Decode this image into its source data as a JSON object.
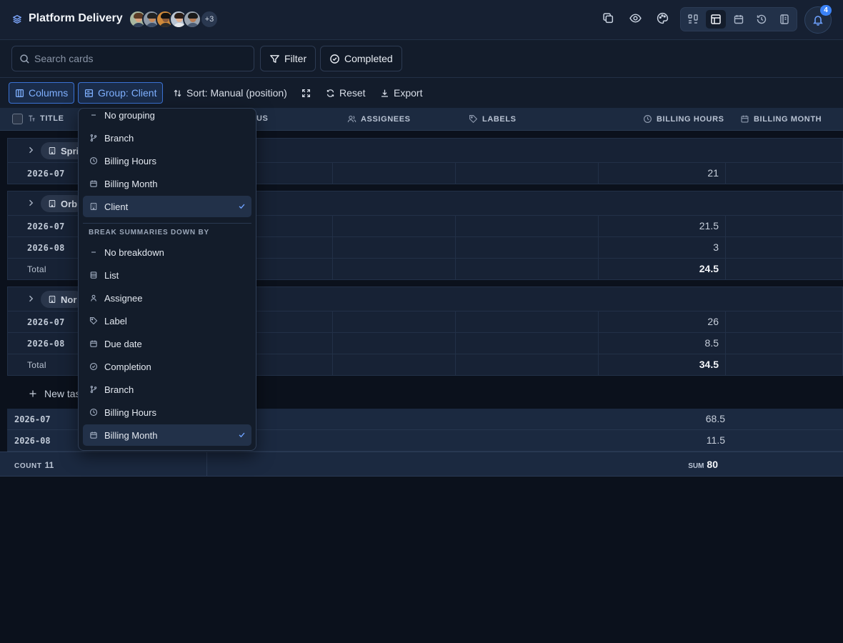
{
  "project": {
    "title": "Platform Delivery",
    "more_members": "+3",
    "notification_count": "4"
  },
  "search": {
    "placeholder": "Search cards"
  },
  "filters": {
    "filter_label": "Filter",
    "completed_label": "Completed"
  },
  "toolbar": {
    "columns_label": "Columns",
    "group_label": "Group: Client",
    "sort_label": "Sort: Manual (position)",
    "reset_label": "Reset",
    "export_label": "Export"
  },
  "table": {
    "headers": {
      "title": "TITLE",
      "status_partial": "US",
      "assignees": "ASSIGNEES",
      "labels": "LABELS",
      "billing_hours": "BILLING HOURS",
      "billing_month": "BILLING MONTH"
    },
    "groups": [
      {
        "name": "Spri",
        "rows": [
          {
            "label": "2026-07",
            "value": "21"
          }
        ]
      },
      {
        "name": "Orb",
        "rows": [
          {
            "label": "2026-07",
            "value": "21.5"
          },
          {
            "label": "2026-08",
            "value": "3"
          }
        ],
        "total_label": "Total",
        "total": "24.5"
      },
      {
        "name": "Nor",
        "rows": [
          {
            "label": "2026-07",
            "value": "26"
          },
          {
            "label": "2026-08",
            "value": "8.5"
          }
        ],
        "total_label": "Total",
        "total": "34.5"
      }
    ],
    "new_task_label": "New tas",
    "overall": [
      {
        "label": "2026-07",
        "value": "68.5"
      },
      {
        "label": "2026-08",
        "value": "11.5"
      }
    ],
    "footer": {
      "count_label": "COUNT",
      "count_value": "11",
      "sum_label": "SUM",
      "sum_value": "80"
    }
  },
  "menu": {
    "group_items": [
      {
        "label": "No grouping",
        "icon": "dash-icon"
      },
      {
        "label": "Branch",
        "icon": "branch-icon"
      },
      {
        "label": "Billing Hours",
        "icon": "clock-icon"
      },
      {
        "label": "Billing Month",
        "icon": "calendar-icon"
      },
      {
        "label": "Client",
        "icon": "building-icon",
        "selected": true
      }
    ],
    "breakdown_header": "BREAK SUMMARIES DOWN BY",
    "breakdown_items": [
      {
        "label": "No breakdown",
        "icon": "dash-icon"
      },
      {
        "label": "List",
        "icon": "list-icon"
      },
      {
        "label": "Assignee",
        "icon": "person-icon"
      },
      {
        "label": "Label",
        "icon": "tag-icon"
      },
      {
        "label": "Due date",
        "icon": "calendar-icon"
      },
      {
        "label": "Completion",
        "icon": "check-circle-icon"
      },
      {
        "label": "Branch",
        "icon": "branch-icon"
      },
      {
        "label": "Billing Hours",
        "icon": "clock-icon"
      },
      {
        "label": "Billing Month",
        "icon": "calendar-icon",
        "selected": true
      }
    ]
  },
  "colors": {
    "accent": "#3b82f6",
    "background": "#0b111c",
    "panel": "#162032"
  }
}
